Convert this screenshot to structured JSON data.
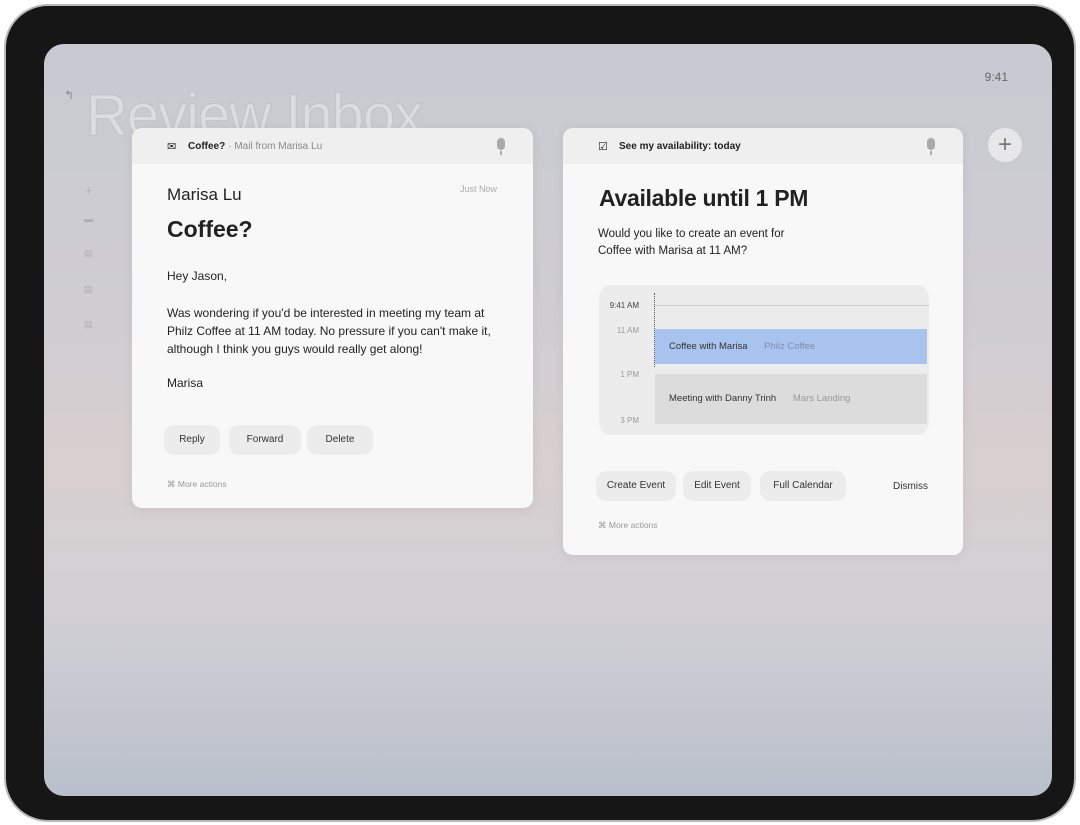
{
  "status_bar": {
    "time": "9:41"
  },
  "background": {
    "title": "Review Inbox",
    "back_icon": "return-arrow-icon",
    "add_icon": "plus"
  },
  "mail_card": {
    "header_subject": "Coffee?",
    "header_source": "· Mail from Marisa Lu",
    "icon": "envelope-icon",
    "sender": "Marisa Lu",
    "timestamp": "Just Now",
    "subject": "Coffee?",
    "greeting": "Hey Jason,",
    "body": "Was wondering if you'd be interested in meeting my team at Philz Coffee at 11 AM today. No pressure if you can't make it, although I think you guys would really get along!",
    "signature": "Marisa",
    "buttons": [
      "Reply",
      "Forward",
      "Delete"
    ],
    "more_actions": "More actions"
  },
  "calendar_card": {
    "header": "See my availability: today",
    "icon": "calendar-check-icon",
    "title": "Available until 1 PM",
    "question": "Would you like to create an event for Coffee with Marisa at 11 AM?",
    "timeline": {
      "now": "9:41 AM",
      "labels": [
        "11 AM",
        "1 PM",
        "3 PM"
      ],
      "events": [
        {
          "title": "Coffee with Marisa",
          "location": "Philz Coffee",
          "color": "#a9c3ef"
        },
        {
          "title": "Meeting with Danny Trinh",
          "location": "Mars Landing",
          "color": "#dcdcdc"
        }
      ]
    },
    "buttons": [
      "Create Event",
      "Edit Event",
      "Full Calendar"
    ],
    "dismiss": "Dismiss",
    "more_actions": "More actions"
  }
}
